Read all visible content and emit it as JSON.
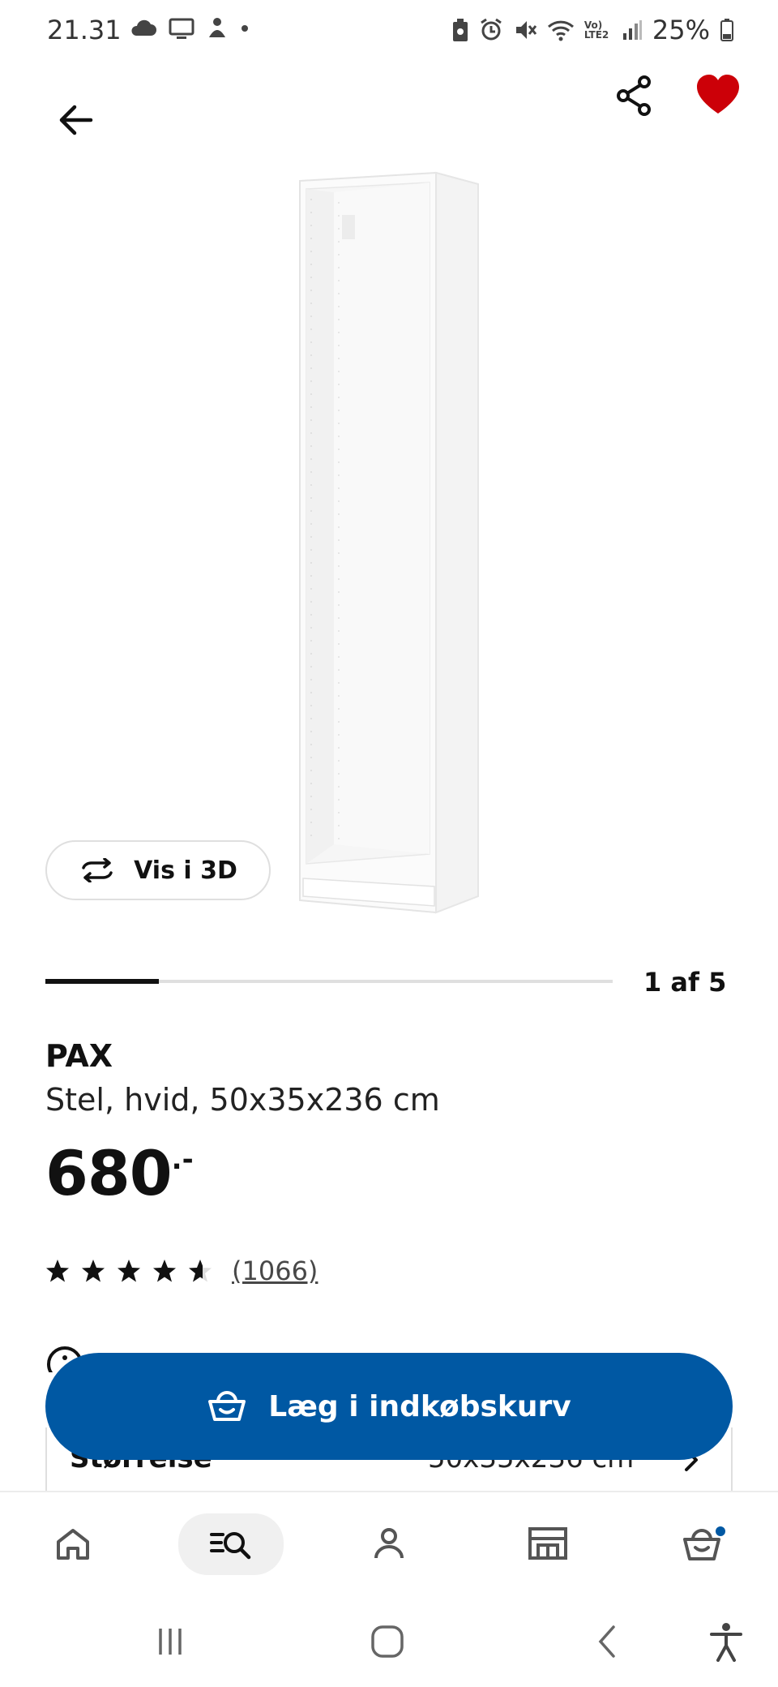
{
  "status_bar": {
    "time": "21.31",
    "battery": "25%",
    "left_icons": [
      "cloud-icon",
      "tv-icon",
      "app-notification-icon",
      "dot-icon"
    ],
    "right_icons": [
      "battery-saver-icon",
      "alarm-icon",
      "mute-icon",
      "wifi-icon",
      "volte-icon",
      "signal-icon",
      "battery-icon"
    ],
    "network_label": "Vo) LTE2"
  },
  "header": {
    "back_icon": "arrow-left-icon",
    "share_icon": "share-icon",
    "favorite_icon": "heart-icon",
    "favorite_color": "#cc0008"
  },
  "gallery": {
    "view3d_label": "Vis i 3D",
    "position_label": "1 af 5",
    "progress_fraction": 0.2
  },
  "product": {
    "name": "PAX",
    "description": "Stel, hvid, 50x35x236 cm",
    "price": "680",
    "price_suffix": ".-",
    "rating": 4.6,
    "rating_max": 5,
    "review_count": "(1066)"
  },
  "size_row": {
    "label": "Størrelse",
    "value": "50x35x236 cm"
  },
  "cart_button": {
    "label": "Læg i indkøbskurv",
    "color": "#0058a3"
  },
  "bottom_nav": {
    "items": [
      "home-icon",
      "search-icon",
      "profile-icon",
      "store-icon",
      "cart-icon"
    ],
    "active": "search-icon",
    "badge_color": "#0058a3"
  },
  "system_nav": [
    "recents-icon",
    "home-button-icon",
    "back-icon",
    "accessibility-icon"
  ]
}
